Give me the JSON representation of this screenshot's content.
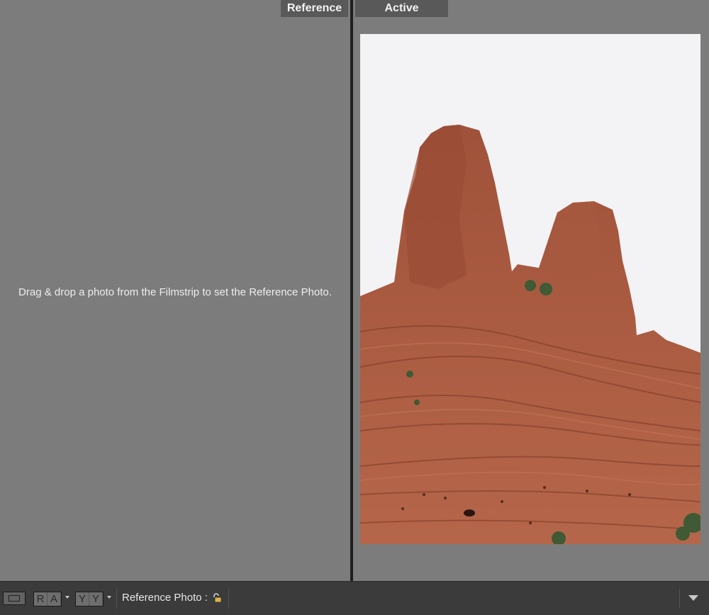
{
  "reference_pane": {
    "tab_label": "Reference",
    "empty_message": "Drag & drop a photo from the Filmstrip to set the Reference Photo."
  },
  "active_pane": {
    "tab_label": "Active",
    "photo": {
      "subject": "red sandstone rock formation against overcast sky"
    }
  },
  "toolbar": {
    "view_mode_icon": "loupe-view-icon",
    "ra_group": [
      "R",
      "A"
    ],
    "yy_group": [
      "Y",
      "Y"
    ],
    "reference_photo_label": "Reference Photo :",
    "lock_icon": "unlocked-padlock-icon",
    "expand_icon": "chevron-down-icon"
  },
  "colors": {
    "background": "#7c7c7c",
    "tab": "#595959",
    "toolbar": "#3b3b3b",
    "divider": "#1f1f1f",
    "rock": "#a85a3e"
  }
}
